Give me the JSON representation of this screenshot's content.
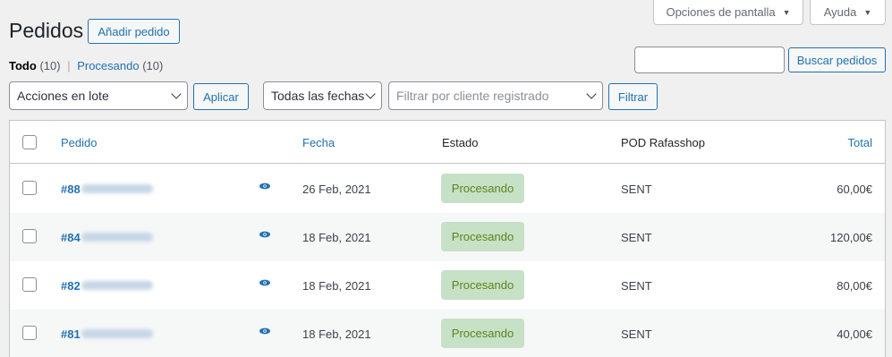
{
  "screen_meta": {
    "options_label": "Opciones de pantalla",
    "help_label": "Ayuda",
    "caret_icon": "▼"
  },
  "header": {
    "title": "Pedidos",
    "add_button": "Añadir pedido"
  },
  "views": {
    "all_label": "Todo",
    "all_count": "(10)",
    "separator": "|",
    "processing_label": "Procesando",
    "processing_count": "(10)"
  },
  "search": {
    "value": "",
    "button": "Buscar pedidos"
  },
  "filters": {
    "bulk_actions": "Acciones en lote",
    "apply": "Aplicar",
    "dates": "Todas las fechas",
    "customer_placeholder": "Filtrar por cliente registrado",
    "filter_button": "Filtrar"
  },
  "table": {
    "columns": {
      "order": "Pedido",
      "date": "Fecha",
      "status": "Estado",
      "pod": "POD Rafasshop",
      "total": "Total"
    },
    "rows": [
      {
        "order": "#88",
        "date": "26 Feb, 2021",
        "status": "Procesando",
        "pod": "SENT",
        "total": "60,00€"
      },
      {
        "order": "#84",
        "date": "18 Feb, 2021",
        "status": "Procesando",
        "pod": "SENT",
        "total": "120,00€"
      },
      {
        "order": "#82",
        "date": "18 Feb, 2021",
        "status": "Procesando",
        "pod": "SENT",
        "total": "80,00€"
      },
      {
        "order": "#81",
        "date": "18 Feb, 2021",
        "status": "Procesando",
        "pod": "SENT",
        "total": "40,00€"
      }
    ]
  },
  "colors": {
    "accent": "#2271b1",
    "status_bg": "#c6e1c6",
    "status_text": "#5b841b"
  }
}
